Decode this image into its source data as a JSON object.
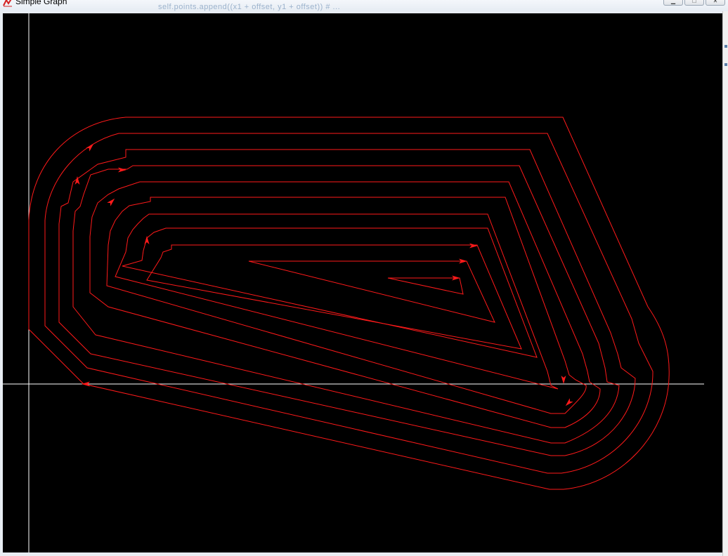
{
  "window": {
    "title": "Simple Graph",
    "background_text": "self.points.append((x1 + offset, y1 + offset))  # ...",
    "controls": {
      "minimize": "▁",
      "maximize": "□",
      "close": "✕"
    }
  },
  "colors": {
    "canvas": "#000000",
    "axes": "#ffffff",
    "path": "#ff1a1a"
  },
  "icons": {
    "app": "graph-icon"
  }
}
